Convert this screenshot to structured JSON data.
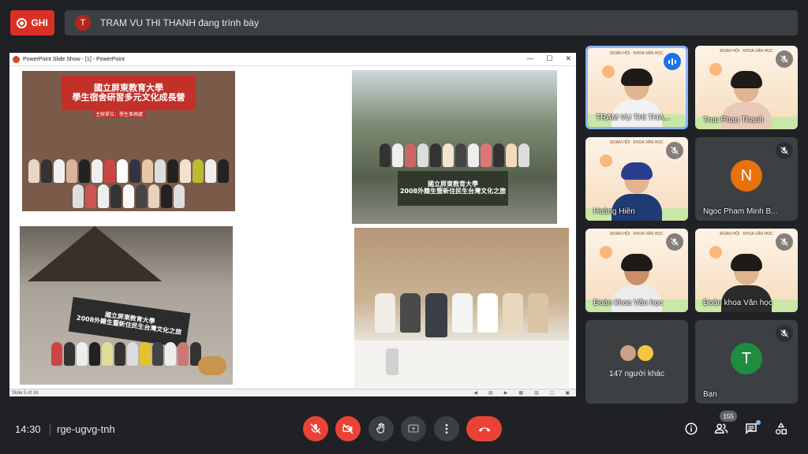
{
  "top": {
    "record_label": "GHI",
    "presenter_initial": "T",
    "presenting_text": "TRAM VU THI THANH đang trình bày"
  },
  "slideshow": {
    "window_title": "PowerPoint Slide Show - [1] - PowerPoint",
    "status": "Slide 5 of 16",
    "photo1_banner": "國立屏東教育大學\n學生宿舍研習多元文化成長營",
    "photo1_sub": "主辦單位：學生事務處",
    "photo2_banner": "國立屏東教育大學\n2008外籍生暨新住民生台灣文化之旅",
    "photo3_banner": "國立屏東教育大學\n2008外籍生暨新住民生台灣文化之旅"
  },
  "participants": [
    {
      "name": "TRAM VU THI THA...",
      "speaking": true
    },
    {
      "name": "Truc Phan Thanh",
      "muted": true
    },
    {
      "name": "Hoàng Hiền",
      "muted": true
    },
    {
      "name": "Ngoc Pham Minh B...",
      "initial": "N",
      "color": "#e8710a",
      "muted": true
    },
    {
      "name": "Đoàn khoa Văn học",
      "muted": true
    },
    {
      "name": "Đoàn khoa Văn học",
      "muted": true
    },
    {
      "name": "147 người khác"
    },
    {
      "name": "Bạn",
      "initial": "T",
      "color": "#1e8e3e",
      "muted": true
    }
  ],
  "bottom": {
    "time": "14:30",
    "meeting_code": "rge-ugvg-tnh",
    "people_count": "155"
  },
  "icons": {
    "controls": [
      "mic-off-icon",
      "camera-off-icon",
      "raise-hand-icon",
      "present-icon",
      "more-options-icon",
      "end-call-icon"
    ],
    "right": [
      "info-icon",
      "people-icon",
      "chat-icon",
      "activities-icon"
    ]
  },
  "colors": {
    "record": "#d93025",
    "end_call": "#ea4335",
    "speaking_border": "#8ab4f8",
    "background": "#202124"
  }
}
